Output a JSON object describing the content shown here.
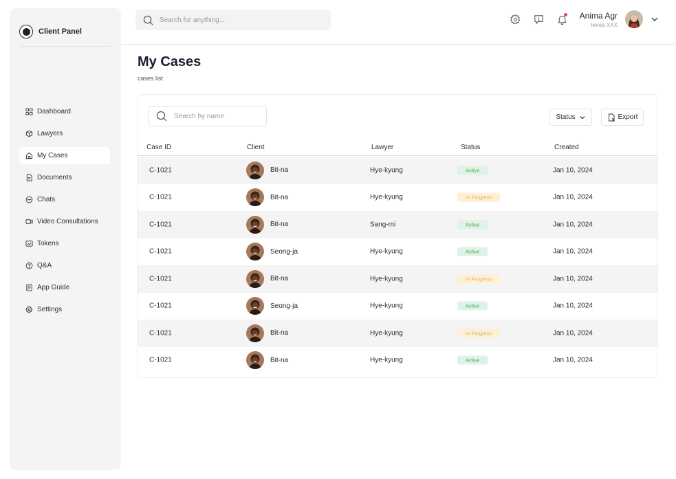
{
  "sidebar": {
    "brand": "Client Panel",
    "items": [
      {
        "label": "Dashboard",
        "icon": "grid-icon"
      },
      {
        "label": "Lawyers",
        "icon": "box-icon"
      },
      {
        "label": "My Cases",
        "icon": "home-icon",
        "active": true
      },
      {
        "label": "Documents",
        "icon": "document-icon"
      },
      {
        "label": "Chats",
        "icon": "chat-icon"
      },
      {
        "label": "Video Consultations",
        "icon": "video-icon"
      },
      {
        "label": "Tokens",
        "icon": "token-icon"
      },
      {
        "label": "Q&A",
        "icon": "question-icon"
      },
      {
        "label": "App Guide",
        "icon": "guide-icon"
      },
      {
        "label": "Settings",
        "icon": "gear-icon"
      }
    ]
  },
  "topbar": {
    "search_placeholder": "Search for anything...",
    "user_name": "Anima Agr",
    "user_sub": "korea XXX"
  },
  "page": {
    "title": "My Cases",
    "subtitle": "cases list"
  },
  "toolbar": {
    "search_placeholder": "Search by name",
    "status_label": "Status",
    "export_label": "Export"
  },
  "table": {
    "columns": [
      "Case ID",
      "Client",
      "Lawyer",
      "Status",
      "Created"
    ],
    "rows": [
      {
        "case_id": "C-1021",
        "client": "Bit-na",
        "lawyer": "Hye-kyung",
        "status": "Active",
        "created": "Jan 10, 2024"
      },
      {
        "case_id": "C-1021",
        "client": "Bit-na",
        "lawyer": "Hye-kyung",
        "status": "In Progress",
        "created": "Jan 10, 2024"
      },
      {
        "case_id": "C-1021",
        "client": "Bit-na",
        "lawyer": "Sang-mi",
        "status": "Active",
        "created": "Jan 10, 2024"
      },
      {
        "case_id": "C-1021",
        "client": "Seong-ja",
        "lawyer": "Hye-kyung",
        "status": "Active",
        "created": "Jan 10, 2024"
      },
      {
        "case_id": "C-1021",
        "client": "Bit-na",
        "lawyer": "Hye-kyung",
        "status": "In Progress",
        "created": "Jan 10, 2024"
      },
      {
        "case_id": "C-1021",
        "client": "Seong-ja",
        "lawyer": "Hye-kyung",
        "status": "Active",
        "created": "Jan 10, 2024"
      },
      {
        "case_id": "C-1021",
        "client": "Bit-na",
        "lawyer": "Hye-kyung",
        "status": "In Progress",
        "created": "Jan 10, 2024"
      },
      {
        "case_id": "C-1021",
        "client": "Bit-na",
        "lawyer": "Hye-kyung",
        "status": "Active",
        "created": "Jan 10, 2024"
      }
    ]
  },
  "colors": {
    "active_bg": "#dff3e4",
    "active_text": "#4aa861",
    "progress_bg": "#fdf0d3",
    "progress_text": "#e1b45c",
    "sidebar_bg": "#f4f4f4",
    "notification_dot": "#e5484d"
  }
}
